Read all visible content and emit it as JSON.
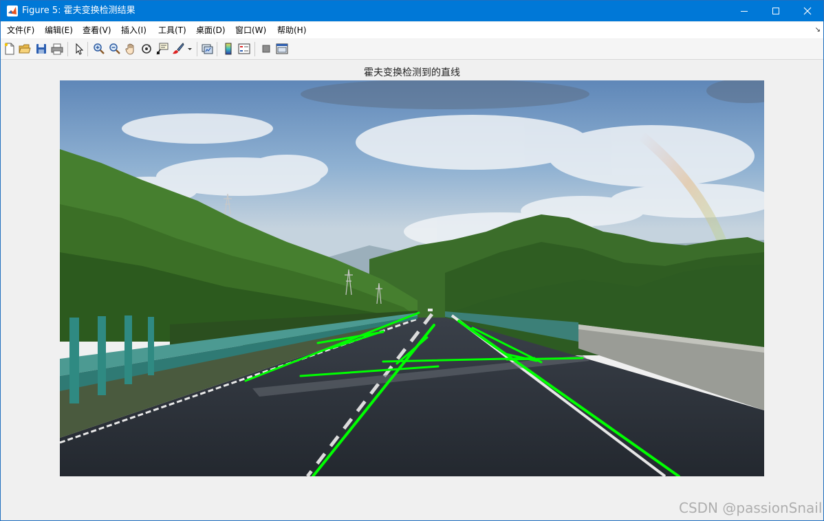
{
  "window": {
    "title": "Figure 5: 霍夫变换检测结果",
    "titlebar_color": "#0078d7",
    "controls": [
      "minimize-icon",
      "maximize-icon",
      "close-icon"
    ]
  },
  "menubar": {
    "items": [
      "文件(F)",
      "编辑(E)",
      "查看(V)",
      "插入(I)",
      "工具(T)",
      "桌面(D)",
      "窗口(W)",
      "帮助(H)"
    ],
    "corner_glyph": "↘"
  },
  "toolbar": {
    "buttons": [
      "new-figure-icon",
      "open-file-icon",
      "save-icon",
      "print-icon",
      "pointer-icon",
      "zoom-in-icon",
      "zoom-out-icon",
      "pan-hand-icon",
      "rotate-3d-icon",
      "data-cursor-icon",
      "brush-icon",
      "brush-dropdown-icon",
      "link-plot-icon",
      "colorbar-icon",
      "legend-icon",
      "hide-plot-tools-icon",
      "show-plot-tools-icon"
    ]
  },
  "figure": {
    "axes_title": "霍夫变换检测到的直线",
    "line_color": "#00ff00",
    "image_description_colors": {
      "sky": "#7fa6cc",
      "hills": "#3f7a2c",
      "road": "#2f353d"
    }
  },
  "watermark": "CSDN @passionSnail"
}
